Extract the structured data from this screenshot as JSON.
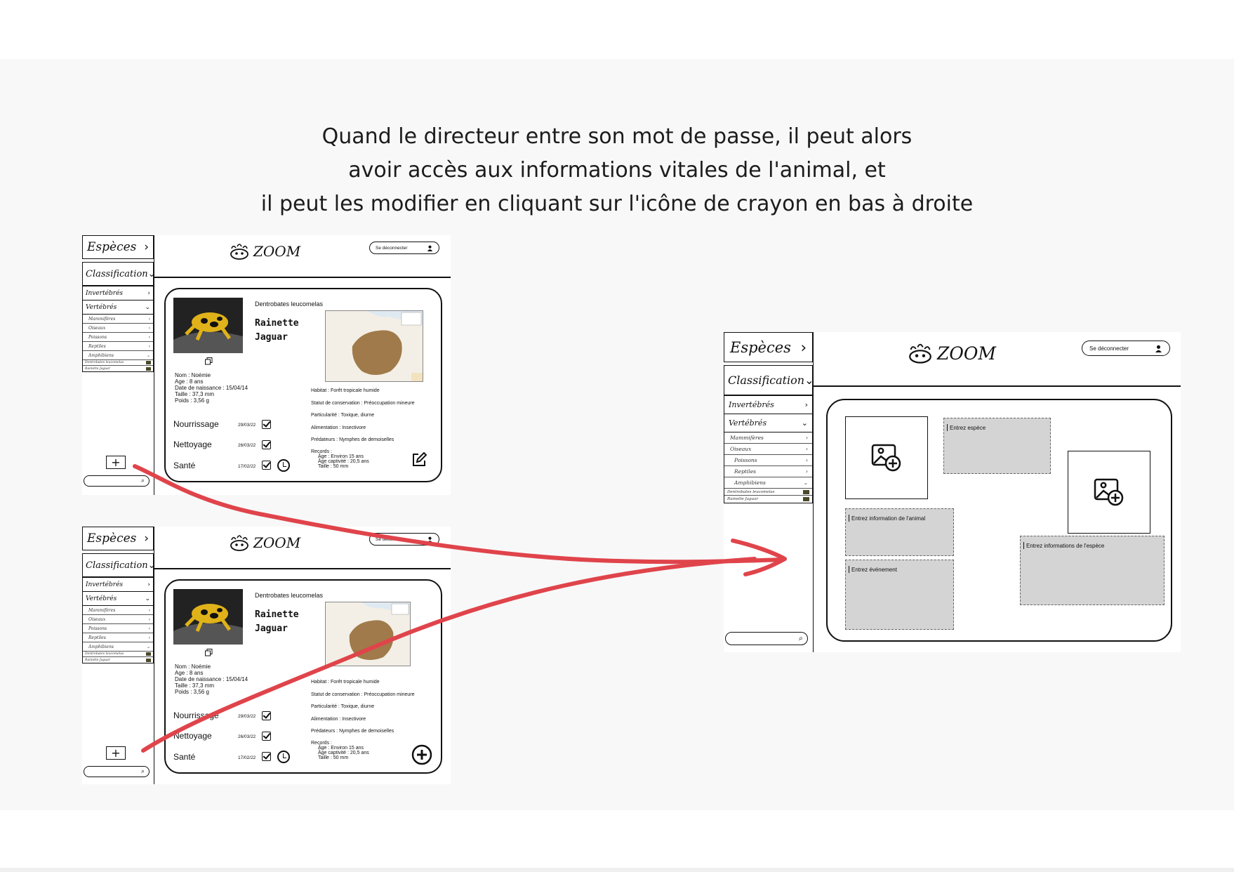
{
  "caption": {
    "line1": "Quand le directeur entre son mot de passe, il peut alors",
    "line2": "avoir accès aux informations vitales de l'animal, et",
    "line3": "il peut les modifier en cliquant sur l'icône de crayon en bas à droite"
  },
  "app": {
    "logo_text": "ZOOM",
    "logout_label": "Se déconnecter"
  },
  "sidebar": {
    "especes": "Espèces",
    "classification": "Classification",
    "invertebres": "Invertébrés",
    "vertebres": "Vertébrés",
    "subitems": [
      "Mammifères",
      "Oiseaux",
      "Poissons",
      "Reptiles",
      "Amphibiens"
    ],
    "thumb_items": [
      "Dentrobates leucomelas",
      "Rainette Jaguar"
    ]
  },
  "animal": {
    "scientific_name": "Dentrobates leucomelas",
    "name_line1": "Rainette",
    "name_line2": "Jaguar",
    "info_nom": "Nom : Noémie",
    "info_age": "Age : 8 ans",
    "info_birth": "Date de naissance : 15/04/14",
    "info_taille": "Taille : 37,3 mm",
    "info_poids": "Poids : 3,56 g",
    "habitat": "Habitat : Forêt tropicale humide",
    "statut": "Statut de conservation : Préoccupation mineure",
    "particularite": "Particularité : Toxique, diurne",
    "alimentation": "Alimentation : Insectivore",
    "predateurs": "Prédateurs : Nymphes de demoiselles",
    "records_title": "Records :",
    "record_age": "Âge : Environ 15 ans",
    "record_captivite": "Âge captivité : 20,5 ans",
    "record_taille": "Taille : 50 mm",
    "tasks": [
      {
        "label": "Nourrissage",
        "date": "29/03/22"
      },
      {
        "label": "Nettoyage",
        "date": "26/03/22"
      },
      {
        "label": "Santé",
        "date": "17/02/22"
      }
    ]
  },
  "form": {
    "entrez_espece": "Entrez espèce",
    "entrez_info_animal": "Entrez information de l'animal",
    "entrez_evenement": "Entrez événement",
    "entrez_info_espece": "Entrez informations de l'espèce"
  },
  "colors": {
    "arrow": "#e0444b",
    "range": "#a07a4a"
  }
}
